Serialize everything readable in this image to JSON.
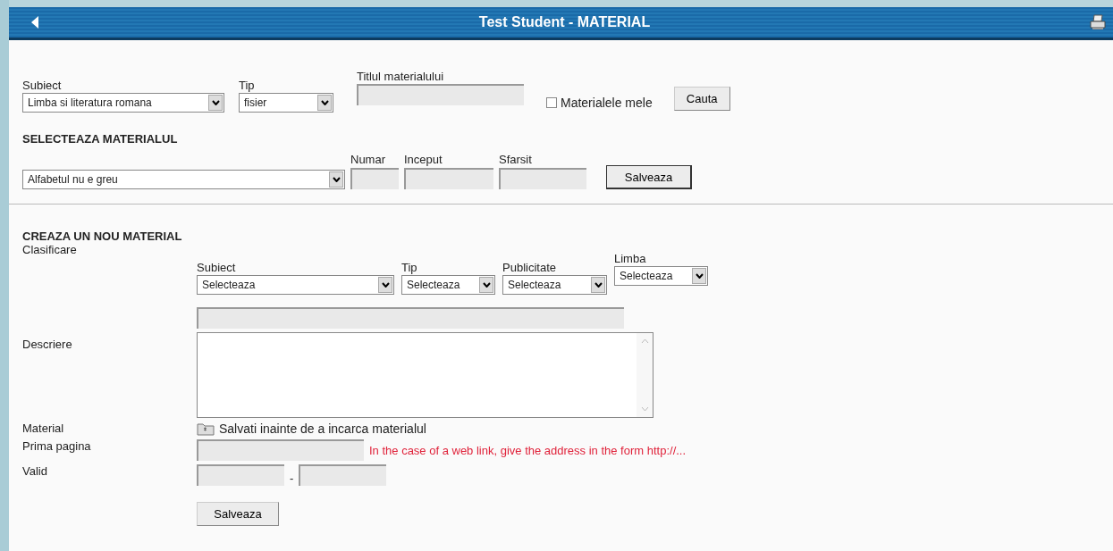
{
  "window": {
    "title": "Test Student - MATERIAL"
  },
  "search": {
    "subject": {
      "label": "Subiect",
      "value": "Limba si literatura romana"
    },
    "type": {
      "label": "Tip",
      "value": "fisier"
    },
    "title": {
      "label": "Titlul materialului"
    },
    "my_materials": {
      "label": "Materialele mele",
      "checked": false
    },
    "button": "Cauta"
  },
  "select_material": {
    "heading": "SELECTEAZA MATERIALUL",
    "material": "Alfabetul nu e greu",
    "fields": [
      {
        "label": "Numar"
      },
      {
        "label": "Inceput"
      },
      {
        "label": "Sfarsit"
      }
    ],
    "button": "Salveaza"
  },
  "create": {
    "heading": "CREAZA UN NOU MATERIAL",
    "classification": {
      "label": "Clasificare",
      "selects": [
        {
          "label": "Subiect",
          "value": "Selecteaza"
        },
        {
          "label": "Tip",
          "value": "Selecteaza"
        },
        {
          "label": "Publicitate",
          "value": "Selecteaza"
        },
        {
          "label": "Limba",
          "value": "Selecteaza"
        }
      ]
    },
    "description": {
      "label": "Descriere"
    },
    "material": {
      "label": "Material",
      "text": "Salvati inainte de a incarca materialul"
    },
    "first_page": {
      "label": "Prima pagina",
      "hint": "In the case of a web link, give the address in the form http://..."
    },
    "valid": {
      "label": "Valid",
      "separator": "-"
    },
    "button": "Salveaza"
  }
}
